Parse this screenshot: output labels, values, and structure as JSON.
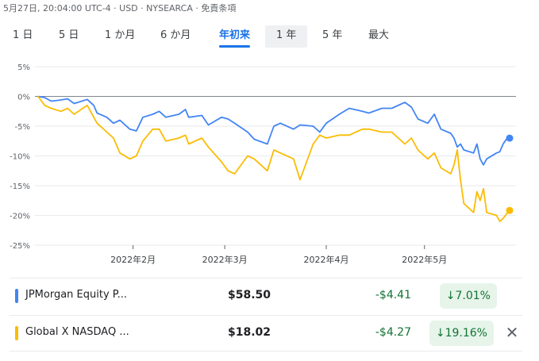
{
  "header": {
    "meta": "5月27日, 20:04:00 UTC-4 · USD · NYSEARCA · 免責条項"
  },
  "tabs": [
    {
      "label": "1 日"
    },
    {
      "label": "5 日"
    },
    {
      "label": "1 か月"
    },
    {
      "label": "6 か月"
    },
    {
      "label": "年初来",
      "active": true
    },
    {
      "label": "1 年"
    },
    {
      "label": "5 年"
    },
    {
      "label": "最大"
    }
  ],
  "chart_data": {
    "type": "line",
    "y_ticks": [
      "5%",
      "0%",
      "-5%",
      "-10%",
      "-15%",
      "-20%",
      "-25%"
    ],
    "y_range": [
      -25,
      5
    ],
    "x_tick_labels": [
      "2022年2月",
      "2022年3月",
      "2022年4月",
      "2022年5月"
    ],
    "x_range": [
      "2022-01-03",
      "2022-05-27"
    ],
    "grid": "horizontal",
    "series": [
      {
        "name": "JPMorgan Equity P...",
        "color": "#4285f4",
        "points": [
          [
            "2022-01-03",
            0
          ],
          [
            "2022-01-05",
            -0.2
          ],
          [
            "2022-01-07",
            -0.8
          ],
          [
            "2022-01-10",
            -0.6
          ],
          [
            "2022-01-12",
            -0.4
          ],
          [
            "2022-01-14",
            -1.2
          ],
          [
            "2022-01-18",
            -0.5
          ],
          [
            "2022-01-20",
            -1.5
          ],
          [
            "2022-01-21",
            -2.8
          ],
          [
            "2022-01-24",
            -3.5
          ],
          [
            "2022-01-26",
            -4.5
          ],
          [
            "2022-01-28",
            -4.0
          ],
          [
            "2022-01-31",
            -5.5
          ],
          [
            "2022-02-02",
            -5.8
          ],
          [
            "2022-02-04",
            -3.5
          ],
          [
            "2022-02-07",
            -3.0
          ],
          [
            "2022-02-09",
            -2.5
          ],
          [
            "2022-02-11",
            -3.5
          ],
          [
            "2022-02-15",
            -3.0
          ],
          [
            "2022-02-17",
            -2.2
          ],
          [
            "2022-02-18",
            -3.5
          ],
          [
            "2022-02-22",
            -3.2
          ],
          [
            "2022-02-24",
            -4.8
          ],
          [
            "2022-02-28",
            -3.5
          ],
          [
            "2022-03-02",
            -3.8
          ],
          [
            "2022-03-04",
            -4.5
          ],
          [
            "2022-03-08",
            -6.0
          ],
          [
            "2022-03-10",
            -7.2
          ],
          [
            "2022-03-14",
            -8.0
          ],
          [
            "2022-03-16",
            -5.0
          ],
          [
            "2022-03-18",
            -4.5
          ],
          [
            "2022-03-22",
            -5.5
          ],
          [
            "2022-03-24",
            -4.8
          ],
          [
            "2022-03-28",
            -5.0
          ],
          [
            "2022-03-30",
            -6.0
          ],
          [
            "2022-04-01",
            -4.5
          ],
          [
            "2022-04-05",
            -3.0
          ],
          [
            "2022-04-08",
            -2.0
          ],
          [
            "2022-04-12",
            -2.5
          ],
          [
            "2022-04-14",
            -2.8
          ],
          [
            "2022-04-18",
            -2.0
          ],
          [
            "2022-04-21",
            -2.0
          ],
          [
            "2022-04-25",
            -1.0
          ],
          [
            "2022-04-27",
            -1.8
          ],
          [
            "2022-04-29",
            -3.8
          ],
          [
            "2022-05-02",
            -4.5
          ],
          [
            "2022-05-04",
            -3.0
          ],
          [
            "2022-05-06",
            -5.5
          ],
          [
            "2022-05-09",
            -6.2
          ],
          [
            "2022-05-10",
            -7.0
          ],
          [
            "2022-05-11",
            -8.5
          ],
          [
            "2022-05-12",
            -8.0
          ],
          [
            "2022-05-13",
            -9.0
          ],
          [
            "2022-05-16",
            -9.5
          ],
          [
            "2022-05-17",
            -8.0
          ],
          [
            "2022-05-18",
            -10.5
          ],
          [
            "2022-05-19",
            -11.5
          ],
          [
            "2022-05-20",
            -10.5
          ],
          [
            "2022-05-23",
            -9.5
          ],
          [
            "2022-05-24",
            -9.3
          ],
          [
            "2022-05-25",
            -8.0
          ],
          [
            "2022-05-26",
            -7.2
          ],
          [
            "2022-05-27",
            -7.01
          ]
        ]
      },
      {
        "name": "Global X NASDAQ ...",
        "color": "#fbbc04",
        "points": [
          [
            "2022-01-03",
            0
          ],
          [
            "2022-01-05",
            -1.5
          ],
          [
            "2022-01-07",
            -2.0
          ],
          [
            "2022-01-10",
            -2.5
          ],
          [
            "2022-01-12",
            -2.0
          ],
          [
            "2022-01-14",
            -3.0
          ],
          [
            "2022-01-18",
            -1.5
          ],
          [
            "2022-01-20",
            -3.5
          ],
          [
            "2022-01-21",
            -4.5
          ],
          [
            "2022-01-24",
            -6.0
          ],
          [
            "2022-01-26",
            -7.0
          ],
          [
            "2022-01-28",
            -9.5
          ],
          [
            "2022-01-31",
            -10.5
          ],
          [
            "2022-02-02",
            -10.0
          ],
          [
            "2022-02-04",
            -7.5
          ],
          [
            "2022-02-07",
            -5.5
          ],
          [
            "2022-02-09",
            -5.5
          ],
          [
            "2022-02-11",
            -7.5
          ],
          [
            "2022-02-15",
            -7.0
          ],
          [
            "2022-02-17",
            -6.5
          ],
          [
            "2022-02-18",
            -8.0
          ],
          [
            "2022-02-22",
            -7.0
          ],
          [
            "2022-02-24",
            -8.5
          ],
          [
            "2022-02-28",
            -11.0
          ],
          [
            "2022-03-02",
            -12.5
          ],
          [
            "2022-03-04",
            -13.0
          ],
          [
            "2022-03-08",
            -10.0
          ],
          [
            "2022-03-10",
            -10.5
          ],
          [
            "2022-03-14",
            -12.5
          ],
          [
            "2022-03-16",
            -9.0
          ],
          [
            "2022-03-18",
            -9.5
          ],
          [
            "2022-03-22",
            -10.5
          ],
          [
            "2022-03-24",
            -14.0
          ],
          [
            "2022-03-28",
            -8.0
          ],
          [
            "2022-03-30",
            -6.5
          ],
          [
            "2022-04-01",
            -7.0
          ],
          [
            "2022-04-05",
            -6.5
          ],
          [
            "2022-04-08",
            -6.5
          ],
          [
            "2022-04-12",
            -5.5
          ],
          [
            "2022-04-14",
            -5.5
          ],
          [
            "2022-04-18",
            -6.0
          ],
          [
            "2022-04-21",
            -6.0
          ],
          [
            "2022-04-25",
            -8.0
          ],
          [
            "2022-04-27",
            -7.0
          ],
          [
            "2022-04-29",
            -9.0
          ],
          [
            "2022-05-02",
            -10.5
          ],
          [
            "2022-05-04",
            -9.5
          ],
          [
            "2022-05-06",
            -12.0
          ],
          [
            "2022-05-09",
            -13.0
          ],
          [
            "2022-05-10",
            -11.5
          ],
          [
            "2022-05-11",
            -9.0
          ],
          [
            "2022-05-12",
            -14.0
          ],
          [
            "2022-05-13",
            -18.0
          ],
          [
            "2022-05-16",
            -19.5
          ],
          [
            "2022-05-17",
            -16.0
          ],
          [
            "2022-05-18",
            -17.5
          ],
          [
            "2022-05-19",
            -15.5
          ],
          [
            "2022-05-20",
            -19.5
          ],
          [
            "2022-05-23",
            -20.0
          ],
          [
            "2022-05-24",
            -21.0
          ],
          [
            "2022-05-25",
            -20.5
          ],
          [
            "2022-05-26",
            -19.8
          ],
          [
            "2022-05-27",
            -19.16
          ]
        ]
      }
    ]
  },
  "tickers": [
    {
      "name": "JPMorgan Equity P...",
      "price": "$58.50",
      "change": "-$4.41",
      "percent": "↓7.01%",
      "color": "#4285f4"
    },
    {
      "name": "Global X NASDAQ ...",
      "price": "$18.02",
      "change": "-$4.27",
      "percent": "↓19.16%",
      "color": "#fbbc04"
    }
  ],
  "actions": {
    "close_glyph": "✕"
  }
}
